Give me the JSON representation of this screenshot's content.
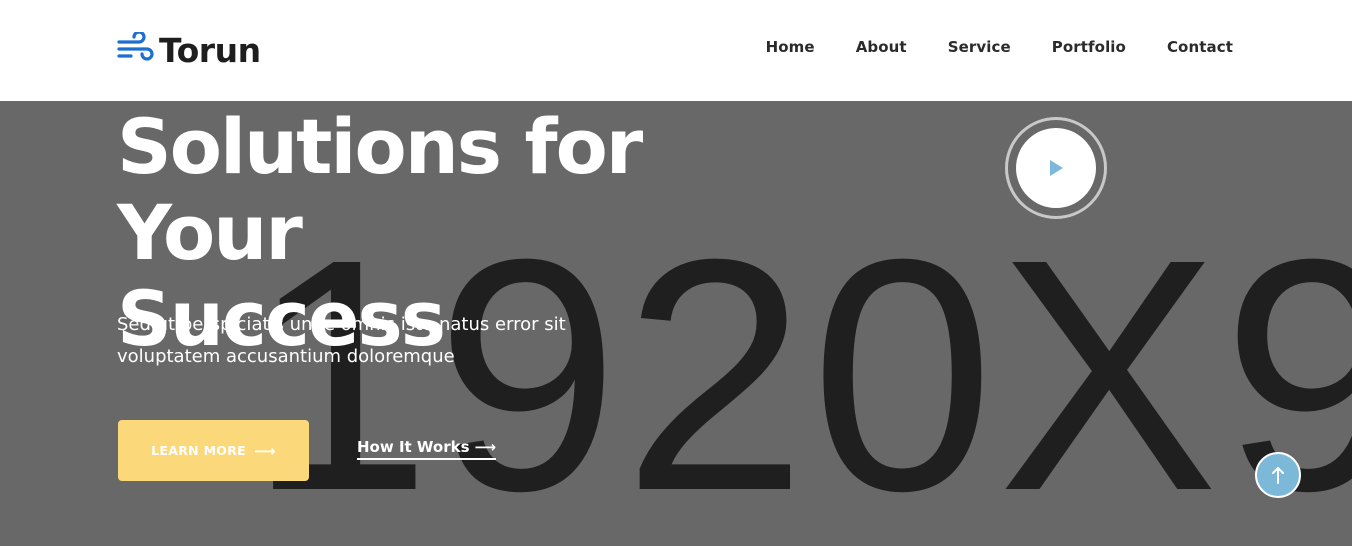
{
  "brand": {
    "name": "Torun",
    "icon": "wind-icon",
    "icon_color": "#1a6fd1"
  },
  "nav": {
    "items": [
      {
        "label": "Home"
      },
      {
        "label": "About"
      },
      {
        "label": "Service"
      },
      {
        "label": "Portfolio"
      },
      {
        "label": "Contact"
      }
    ]
  },
  "hero": {
    "title_line1": "Solutions for Your",
    "title_line2": "Success",
    "description": "Sed ut perspiciatis unde omnis iste natus error sit voluptatem accusantium doloremque",
    "primary_button": {
      "label": "LEARN MORE",
      "icon": "arrow-right-icon"
    },
    "secondary_link": {
      "label": "How It Works",
      "icon": "arrow-right-icon"
    },
    "background_placeholder": "1920X9",
    "background_color": "#686868"
  },
  "video": {
    "icon": "play-icon",
    "icon_color": "#7cb8d8"
  },
  "scroll_top": {
    "icon": "arrow-up-icon",
    "color": "#7cb8d8"
  },
  "colors": {
    "accent_yellow": "#fbd97a",
    "accent_blue": "#7cb8d8"
  }
}
